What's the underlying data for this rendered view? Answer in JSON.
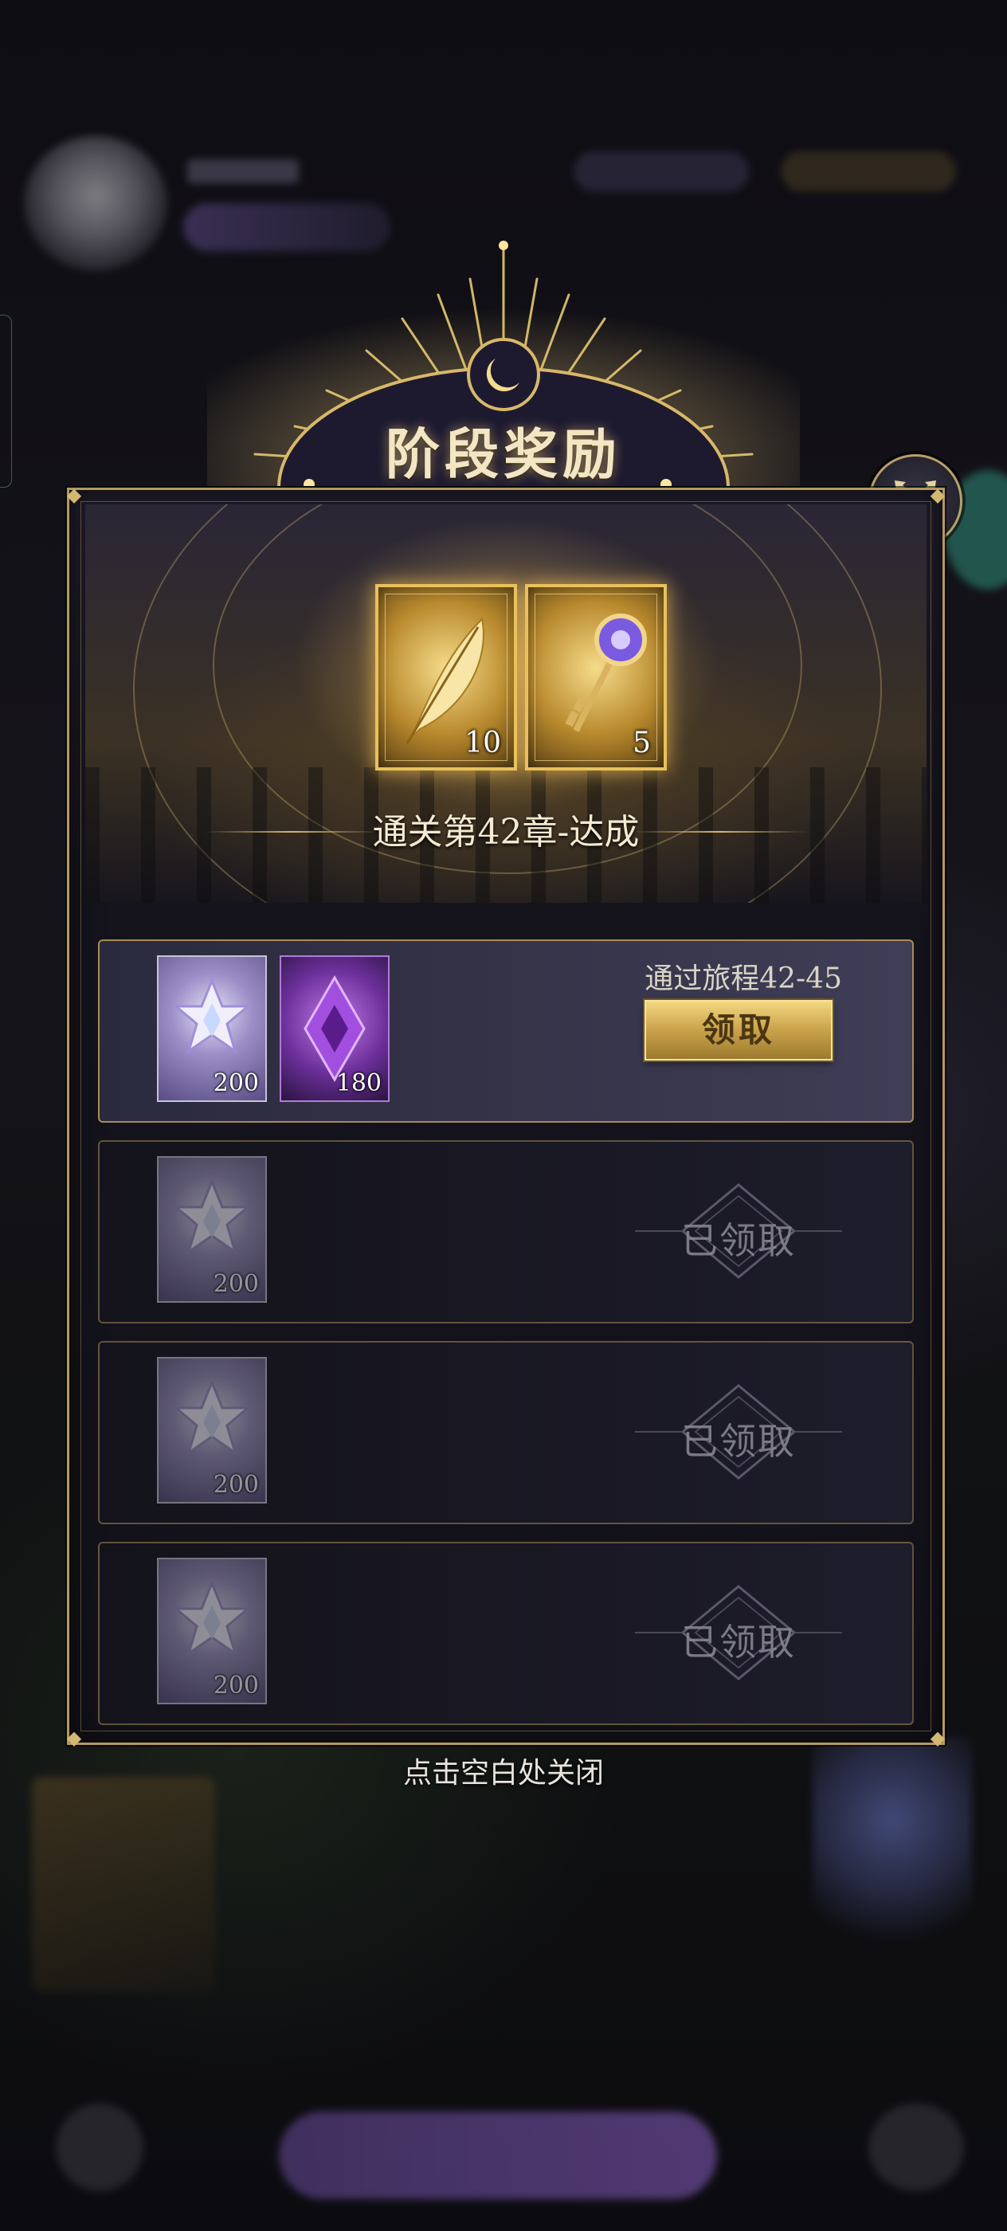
{
  "modal": {
    "title": "阶段奖励",
    "milestone": {
      "text": "通关第42章-达成",
      "rewards": [
        {
          "icon": "golden-feather-icon",
          "count": "10"
        },
        {
          "icon": "jeweled-key-icon",
          "count": "5"
        }
      ]
    },
    "rows": [
      {
        "condition": "通过旅程42-45",
        "state": "claimable",
        "button_label": "领取",
        "items": [
          {
            "icon": "star-crystal-icon",
            "count": "200"
          },
          {
            "icon": "purple-gem-icon",
            "count": "180"
          }
        ]
      },
      {
        "state": "claimed",
        "status_label": "已领取",
        "items": [
          {
            "icon": "star-crystal-icon",
            "count": "200"
          }
        ]
      },
      {
        "state": "claimed",
        "status_label": "已领取",
        "items": [
          {
            "icon": "star-crystal-icon",
            "count": "200"
          }
        ]
      },
      {
        "state": "claimed",
        "status_label": "已领取",
        "items": [
          {
            "icon": "star-crystal-icon",
            "count": "200"
          }
        ]
      }
    ],
    "close_icon": "close-icon",
    "dismiss_hint": "点击空白处关闭"
  },
  "colors": {
    "gold_accent": "#d4b872",
    "button_gold": "#caa24a",
    "panel_bg": "#15141d",
    "claimed_text": "#8d8a98"
  }
}
